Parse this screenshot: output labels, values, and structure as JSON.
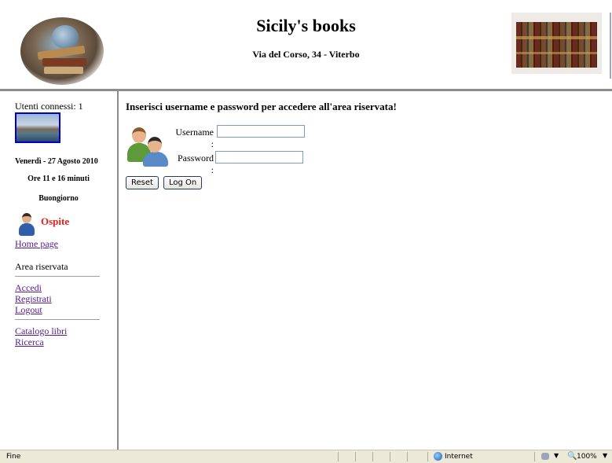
{
  "header": {
    "title": "Sicily's books",
    "address": "Via del Corso, 34 - Viterbo"
  },
  "sidebar": {
    "users_online": "Utenti connessi: 1",
    "date": "Venerdì - 27 Agosto 2010",
    "time": "Ore 11 e 16 minuti",
    "greeting": "Buongiorno",
    "guest": "Ospite",
    "home_link": "Home page",
    "area_title": "Area riservata",
    "area_links": [
      "Accedi",
      "Registrati",
      "Logout"
    ],
    "other_links": [
      "Catalogo libri",
      "Ricerca"
    ]
  },
  "login": {
    "heading": "Inserisci username e password per accedere all'area riservata!",
    "username_label": "Username :",
    "username_value": "",
    "password_label": "Password :",
    "password_value": "",
    "reset_label": "Reset",
    "logon_label": "Log On"
  },
  "statusbar": {
    "status": "Fine",
    "zone": "Internet",
    "zoom": "100%"
  },
  "colors": {
    "guest": "#e8201a",
    "link": "#551a8b",
    "rule": "#8c8c8c",
    "statusbar": "#ece9d8"
  }
}
